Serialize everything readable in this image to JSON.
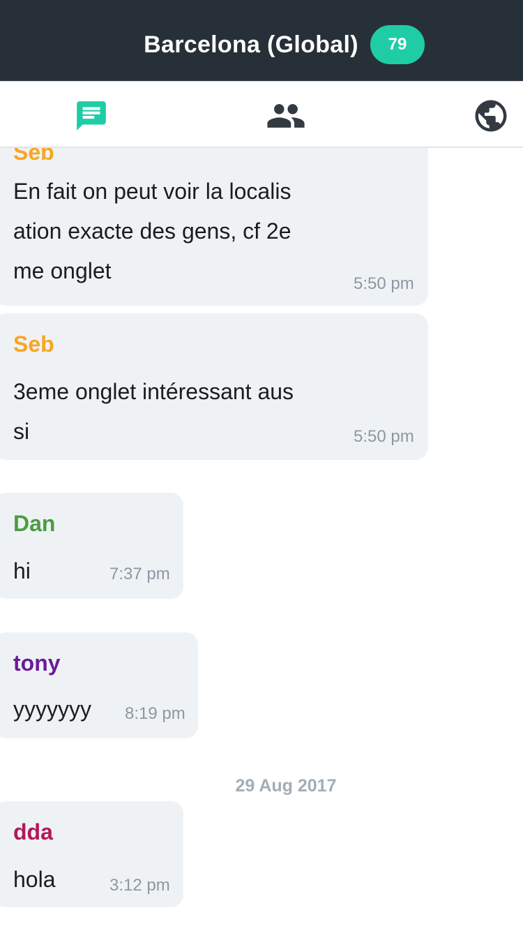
{
  "header": {
    "title": "Barcelona (Global)",
    "member_count": "79",
    "background": "#273038",
    "badge_color": "#1ecda5"
  },
  "tabs": [
    {
      "icon": "chat-icon",
      "active": true
    },
    {
      "icon": "people-icon",
      "active": false
    },
    {
      "icon": "globe-icon",
      "active": false
    }
  ],
  "messages": [
    {
      "sender": "Seb",
      "sender_color": "#f6a623",
      "lines": [
        "En fait on peut voir la localis",
        "ation exacte des gens, cf 2e",
        "me onglet"
      ],
      "time": "5:50 pm"
    },
    {
      "sender": "Seb",
      "sender_color": "#f6a623",
      "lines": [
        "3eme onglet intéressant aus",
        "si"
      ],
      "time": "5:50 pm"
    },
    {
      "sender": "Dan",
      "sender_color": "#4a9d3f",
      "lines": [
        "hi"
      ],
      "time": "7:37 pm"
    },
    {
      "sender": "tony",
      "sender_color": "#6a1b9a",
      "lines": [
        "yyyyyyy"
      ],
      "time": "8:19 pm"
    },
    {
      "sender": "dda",
      "sender_color": "#b3175a",
      "lines": [
        "hola"
      ],
      "time": "3:12 pm"
    }
  ],
  "date_separator": "29 Aug 2017"
}
